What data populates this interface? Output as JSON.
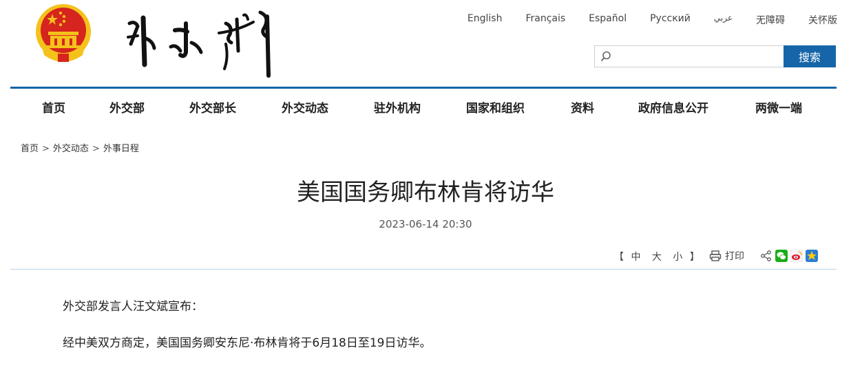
{
  "header": {
    "languages": [
      "English",
      "Français",
      "Español",
      "Русский",
      "عربي",
      "无障碍",
      "关怀版"
    ],
    "search": {
      "placeholder": "",
      "value": "",
      "button_label": "搜索"
    }
  },
  "nav": {
    "items": [
      "首页",
      "外交部",
      "外交部长",
      "外交动态",
      "驻外机构",
      "国家和组织",
      "资料",
      "政府信息公开",
      "两微一端"
    ]
  },
  "breadcrumb": {
    "items": [
      "首页",
      "外交动态",
      "外事日程"
    ],
    "separator": ">"
  },
  "article": {
    "title": "美国国务卿布林肯将访华",
    "date": "2023-06-14 20:30",
    "font_controls": {
      "open": "【",
      "small": "中",
      "medium": "大",
      "large": "小",
      "close": "】"
    },
    "print_label": "打印",
    "paragraphs": [
      "外交部发言人汪文斌宣布：",
      "经中美双方商定，美国国务卿安东尼·布林肯将于6月18日至19日访华。"
    ]
  },
  "colors": {
    "accent": "#1565a8",
    "emblem_red": "#d6241e",
    "emblem_gold": "#f4c21b"
  },
  "icons": [
    "national-emblem-icon",
    "search-icon",
    "printer-icon",
    "share-icon",
    "wechat-icon",
    "weibo-icon",
    "qzone-icon"
  ]
}
